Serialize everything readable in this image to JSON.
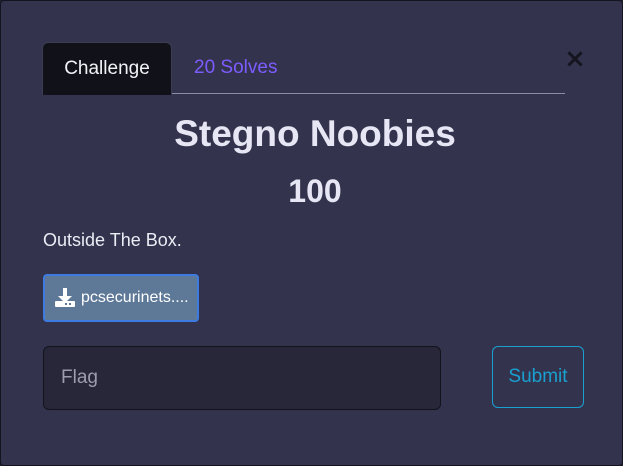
{
  "modal": {
    "close_symbol": "×",
    "tabs": [
      {
        "label": "Challenge",
        "active": true
      },
      {
        "label": "20 Solves",
        "active": false
      }
    ],
    "challenge": {
      "name": "Stegno Noobies",
      "value": "100",
      "description": "Outside The Box.",
      "file_label": "pcsecurinets....",
      "file_icon": "download-icon"
    },
    "flag_form": {
      "placeholder": "Flag",
      "value": "",
      "submit_label": "Submit"
    }
  },
  "colors": {
    "background": "#33334e",
    "tab_active_bg": "#11111a",
    "solves_link": "#7d5cff",
    "file_button_bg": "#5e7898",
    "file_button_border": "#3e7be0",
    "submit_accent": "#1aa0d0"
  }
}
